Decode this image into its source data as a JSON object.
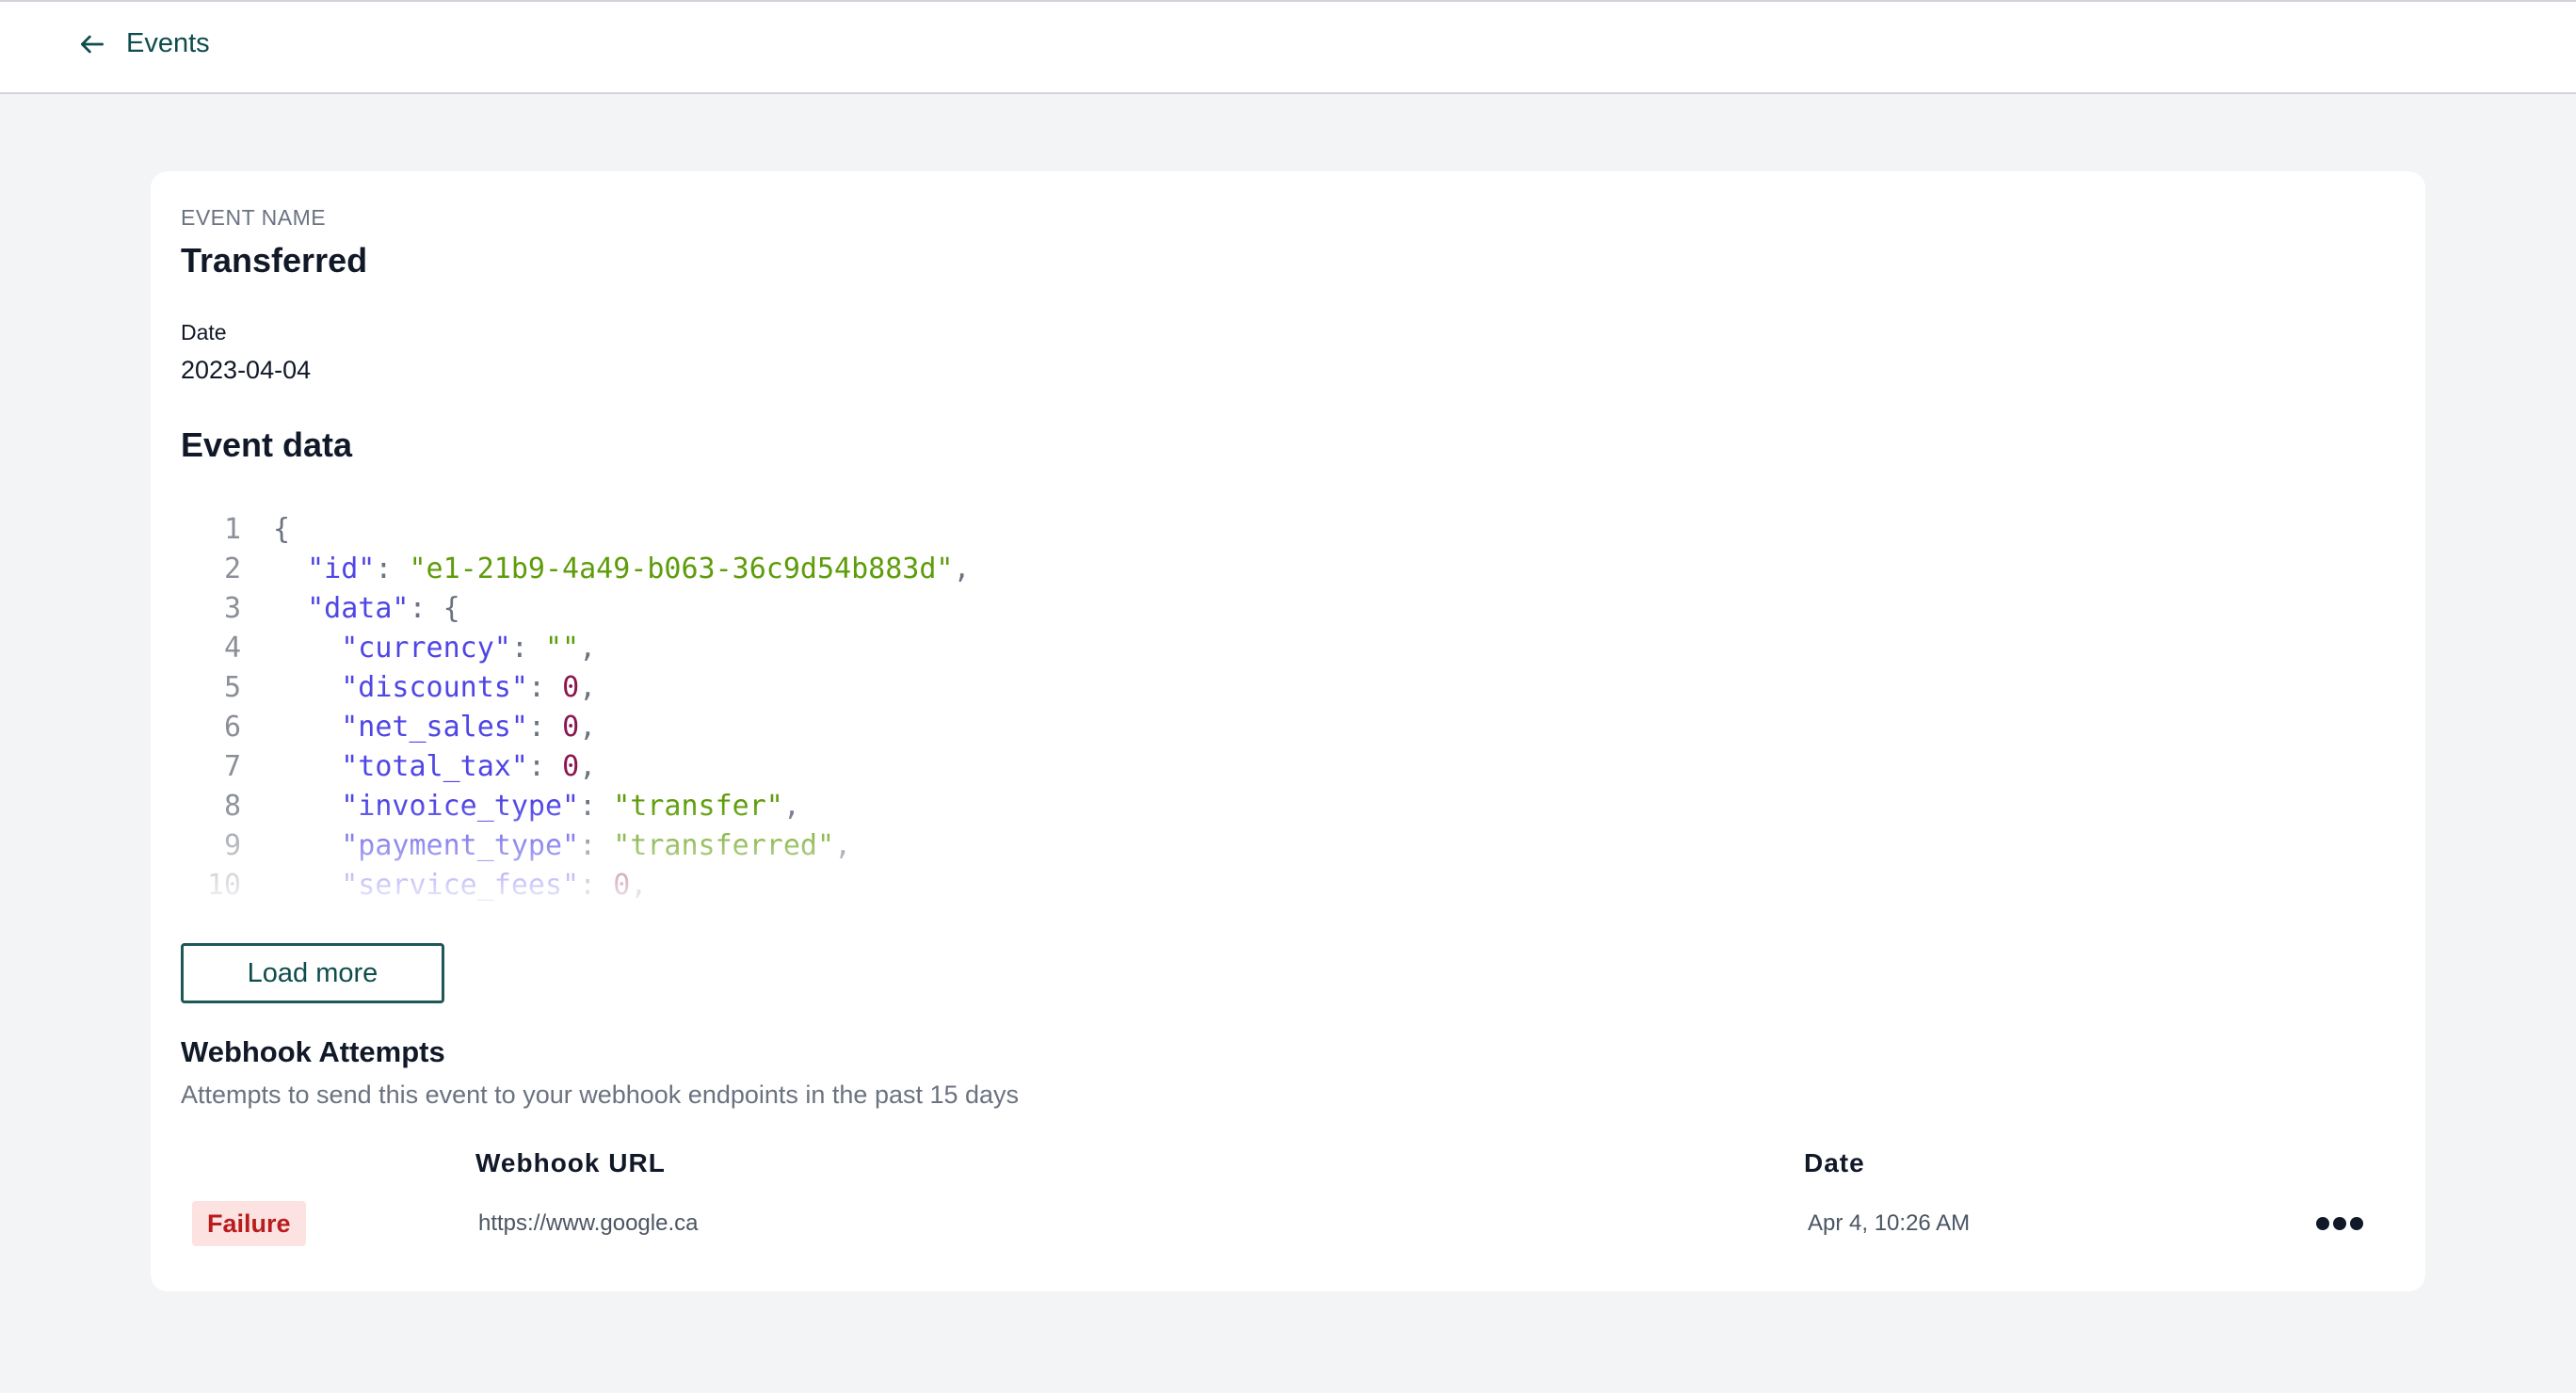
{
  "nav": {
    "back_label": "Events"
  },
  "event": {
    "name_label": "EVENT NAME",
    "name": "Transferred",
    "date_label": "Date",
    "date": "2023-04-04"
  },
  "event_data": {
    "heading": "Event data",
    "lines": [
      {
        "n": "1",
        "tokens": [
          {
            "t": "p",
            "v": "{"
          }
        ]
      },
      {
        "n": "2",
        "tokens": [
          {
            "t": "p",
            "v": "  "
          },
          {
            "t": "k",
            "v": "\"id\""
          },
          {
            "t": "p",
            "v": ": "
          },
          {
            "t": "s",
            "v": "\"e1-21b9-4a49-b063-36c9d54b883d\""
          },
          {
            "t": "p",
            "v": ","
          }
        ]
      },
      {
        "n": "3",
        "tokens": [
          {
            "t": "p",
            "v": "  "
          },
          {
            "t": "k",
            "v": "\"data\""
          },
          {
            "t": "p",
            "v": ": {"
          }
        ]
      },
      {
        "n": "4",
        "tokens": [
          {
            "t": "p",
            "v": "    "
          },
          {
            "t": "k",
            "v": "\"currency\""
          },
          {
            "t": "p",
            "v": ": "
          },
          {
            "t": "s",
            "v": "\"\""
          },
          {
            "t": "p",
            "v": ","
          }
        ]
      },
      {
        "n": "5",
        "tokens": [
          {
            "t": "p",
            "v": "    "
          },
          {
            "t": "k",
            "v": "\"discounts\""
          },
          {
            "t": "p",
            "v": ": "
          },
          {
            "t": "n",
            "v": "0"
          },
          {
            "t": "p",
            "v": ","
          }
        ]
      },
      {
        "n": "6",
        "tokens": [
          {
            "t": "p",
            "v": "    "
          },
          {
            "t": "k",
            "v": "\"net_sales\""
          },
          {
            "t": "p",
            "v": ": "
          },
          {
            "t": "n",
            "v": "0"
          },
          {
            "t": "p",
            "v": ","
          }
        ]
      },
      {
        "n": "7",
        "tokens": [
          {
            "t": "p",
            "v": "    "
          },
          {
            "t": "k",
            "v": "\"total_tax\""
          },
          {
            "t": "p",
            "v": ": "
          },
          {
            "t": "n",
            "v": "0"
          },
          {
            "t": "p",
            "v": ","
          }
        ]
      },
      {
        "n": "8",
        "tokens": [
          {
            "t": "p",
            "v": "    "
          },
          {
            "t": "k",
            "v": "\"invoice_type\""
          },
          {
            "t": "p",
            "v": ": "
          },
          {
            "t": "s",
            "v": "\"transfer\""
          },
          {
            "t": "p",
            "v": ","
          }
        ]
      },
      {
        "n": "9",
        "tokens": [
          {
            "t": "p",
            "v": "    "
          },
          {
            "t": "k",
            "v": "\"payment_type\""
          },
          {
            "t": "p",
            "v": ": "
          },
          {
            "t": "s",
            "v": "\"transferred\""
          },
          {
            "t": "p",
            "v": ","
          }
        ]
      },
      {
        "n": "10",
        "tokens": [
          {
            "t": "p",
            "v": "    "
          },
          {
            "t": "k",
            "v": "\"service_fees\""
          },
          {
            "t": "p",
            "v": ": "
          },
          {
            "t": "n",
            "v": "0"
          },
          {
            "t": "p",
            "v": ","
          }
        ]
      }
    ],
    "load_more_label": "Load more"
  },
  "webhooks": {
    "title": "Webhook Attempts",
    "subtitle": "Attempts to send this event to your webhook endpoints in the past 15 days",
    "columns": {
      "url": "Webhook URL",
      "date": "Date"
    },
    "rows": [
      {
        "status": "Failure",
        "url": "https://www.google.ca",
        "date": "Apr 4, 10:26 AM"
      }
    ]
  },
  "colors": {
    "brand": "#0f4c4c",
    "json_key": "#4f46e5",
    "json_string": "#5e9c0a",
    "json_number": "#8b1650",
    "failure_bg": "#fde2e2",
    "failure_text": "#b91c1c"
  },
  "icons": {
    "back": "arrow-left-icon",
    "more": "more-horizontal-icon"
  }
}
